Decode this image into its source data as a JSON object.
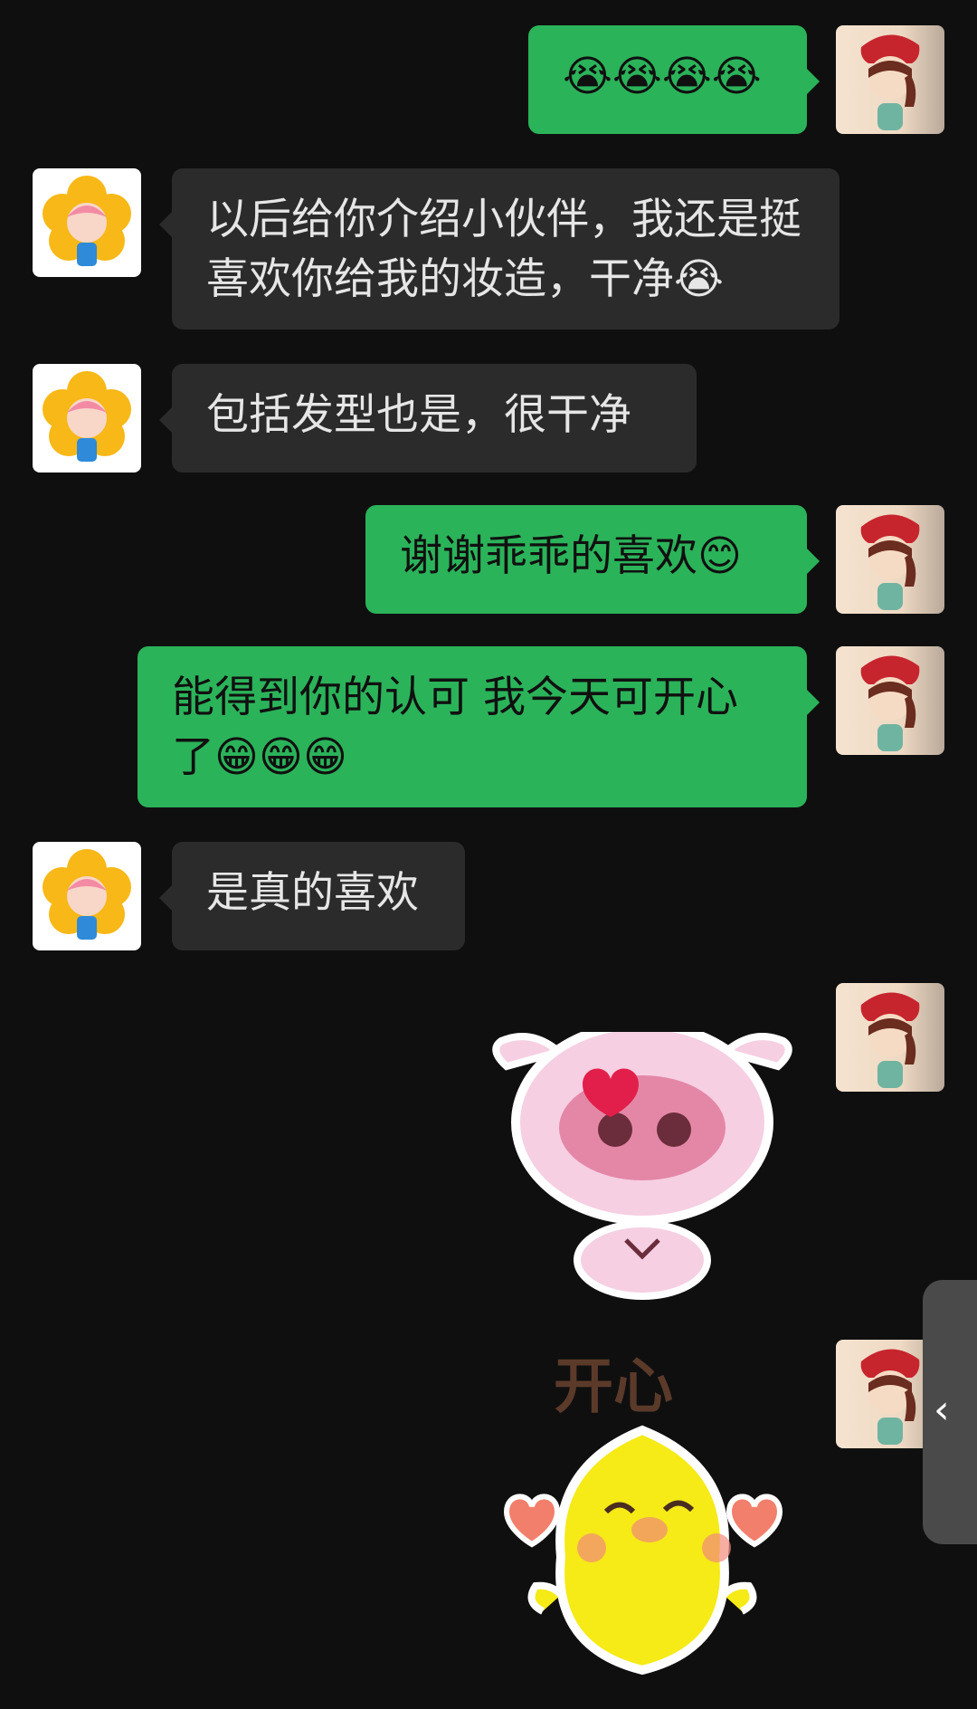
{
  "messages": [
    {
      "side": "self",
      "text": "😭😭😭😭"
    },
    {
      "side": "other",
      "text": "以后给你介绍小伙伴，我还是挺喜欢你给我的妆造，干净😭"
    },
    {
      "side": "other",
      "text": "包括发型也是，很干净"
    },
    {
      "side": "self",
      "text": "谢谢乖乖的喜欢😊"
    },
    {
      "side": "self",
      "text": "能得到你的认可  我今天可开心了😁😁😁"
    },
    {
      "side": "other",
      "text": "是真的喜欢"
    }
  ],
  "stickers": [
    {
      "name": "pig-sticker"
    },
    {
      "name": "chick-sticker",
      "caption": "开心"
    }
  ],
  "ui": {
    "side_tab_icon": "‹",
    "colors": {
      "background": "#0f0f0f",
      "self_bubble": "#2bb35a",
      "other_bubble": "#2b2b2b"
    }
  }
}
